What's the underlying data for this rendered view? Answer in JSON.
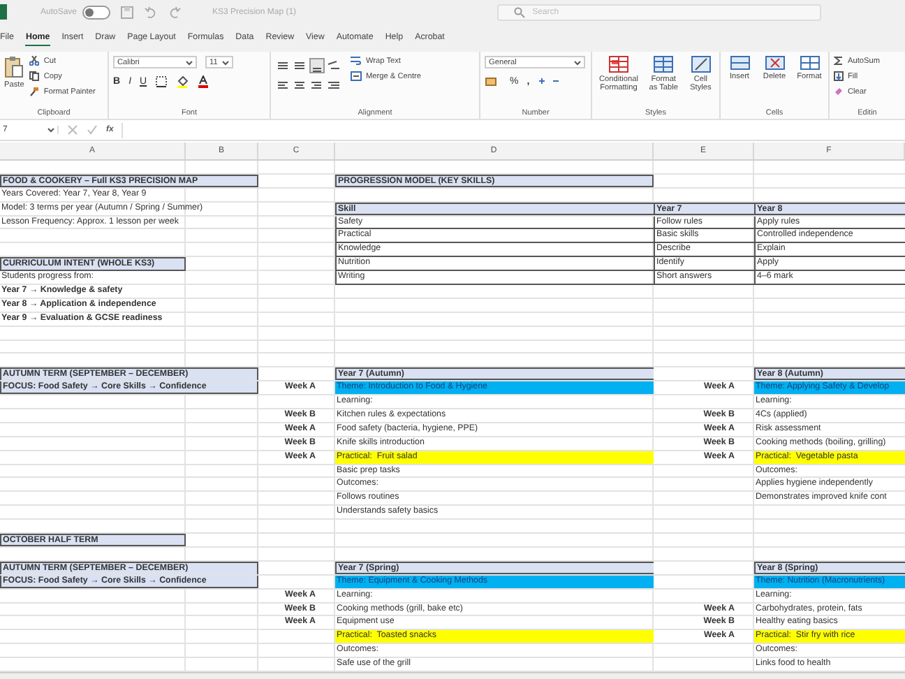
{
  "app": {
    "autosave": {
      "label": "AutoSave",
      "on": false
    },
    "title": "KS3 Precision Map (1)",
    "search": {
      "placeholder": "Search"
    }
  },
  "menu_tabs": [
    {
      "label": "File",
      "selected": false
    },
    {
      "label": "Home",
      "selected": true
    },
    {
      "label": "Insert",
      "selected": false
    },
    {
      "label": "Draw",
      "selected": false
    },
    {
      "label": "Page Layout",
      "selected": false
    },
    {
      "label": "Formulas",
      "selected": false
    },
    {
      "label": "Data",
      "selected": false
    },
    {
      "label": "Review",
      "selected": false
    },
    {
      "label": "View",
      "selected": false
    },
    {
      "label": "Automate",
      "selected": false
    },
    {
      "label": "Help",
      "selected": false
    },
    {
      "label": "Acrobat",
      "selected": false
    }
  ],
  "ribbon": {
    "clipboard": {
      "paste": "Paste",
      "cut": "Cut",
      "copy": "Copy",
      "format_painter": "Format Painter",
      "label": "Clipboard"
    },
    "font": {
      "family": "Calibri",
      "size": "11",
      "bold": "B",
      "italic": "I",
      "underline": "U",
      "label": "Font"
    },
    "alignment": {
      "wrap_text": "Wrap Text",
      "merge": "Merge & Centre",
      "label": "Alignment"
    },
    "number": {
      "format": "General",
      "percent": "%",
      "comma": ",",
      "label": "Number"
    },
    "styles": {
      "conditional": "Conditional Formatting",
      "format_table": "Format as Table",
      "cell_styles": "Cell Styles",
      "label": "Styles"
    },
    "cells": {
      "insert": "Insert",
      "delete": "Delete",
      "format": "Format",
      "label": "Cells"
    },
    "editing": {
      "autosum": "AutoSum",
      "fill": "Fill",
      "clear": "Clear",
      "label": "Editin"
    }
  },
  "formula_bar": {
    "name_box": "7",
    "function_label": "fx"
  },
  "columns": [
    "A",
    "B",
    "C",
    "D",
    "E",
    "F"
  ],
  "rows": [
    {},
    {
      "column_a": {
        "text": "FOOD & COOKERY – Full KS3 PRECISION MAP",
        "kind": "section_wide"
      },
      "column_d": {
        "text": "PROGRESSION MODEL (KEY SKILLS)",
        "kind": "section"
      }
    },
    {
      "column_a": {
        "text": "Years Covered: Year 7, Year 8, Year 9",
        "kind": "plain"
      }
    },
    {
      "column_a": {
        "text": "Model: 3 terms per year (Autumn / Spring / Summer)",
        "kind": "plain"
      },
      "column_d": {
        "text": "Skill",
        "kind": "table_head"
      },
      "column_e": {
        "text": "Year 7",
        "kind": "table_head"
      },
      "column_f": {
        "text": "Year 8",
        "kind": "table_head"
      }
    },
    {
      "column_a": {
        "text": "Lesson Frequency: Approx. 1 lesson per week",
        "kind": "plain"
      },
      "column_d": {
        "text": "Safety",
        "kind": "table"
      },
      "column_e": {
        "text": "Follow rules",
        "kind": "table"
      },
      "column_f": {
        "text": "Apply rules",
        "kind": "table"
      }
    },
    {
      "column_d": {
        "text": "Practical",
        "kind": "table"
      },
      "column_e": {
        "text": "Basic skills",
        "kind": "table"
      },
      "column_f": {
        "text": "Controlled independence",
        "kind": "table"
      }
    },
    {
      "column_d": {
        "text": "Knowledge",
        "kind": "table"
      },
      "column_e": {
        "text": "Describe",
        "kind": "table"
      },
      "column_f": {
        "text": "Explain",
        "kind": "table"
      }
    },
    {
      "column_a": {
        "text": "CURRICULUM INTENT (WHOLE KS3)",
        "kind": "section"
      },
      "column_d": {
        "text": "Nutrition",
        "kind": "table"
      },
      "column_e": {
        "text": "Identify",
        "kind": "table"
      },
      "column_f": {
        "text": "Apply",
        "kind": "table"
      }
    },
    {
      "column_a": {
        "text": "Students progress from:",
        "kind": "plain"
      },
      "column_d": {
        "text": "Writing",
        "kind": "table"
      },
      "column_e": {
        "text": "Short answers",
        "kind": "table"
      },
      "column_f": {
        "text": "4–6 mark",
        "kind": "table"
      }
    },
    {
      "column_a": {
        "text": "Year 7 → Knowledge & safety",
        "kind": "bold"
      }
    },
    {
      "column_a": {
        "text": "Year 8 → Application & independence",
        "kind": "bold"
      }
    },
    {
      "column_a": {
        "text": "Year 9 → Evaluation & GCSE readiness",
        "kind": "bold"
      }
    },
    {},
    {},
    {},
    {
      "column_a": {
        "text": "AUTUMN TERM (SEPTEMBER – DECEMBER)",
        "kind": "section_top"
      },
      "column_d": {
        "text": "Year 7 (Autumn)",
        "kind": "table_head"
      },
      "column_f": {
        "text": "Year 8 (Autumn)",
        "kind": "table_head"
      }
    },
    {
      "column_a": {
        "text": "FOCUS: Food Safety → Core Skills → Confidence",
        "kind": "section_bottom"
      },
      "column_c": {
        "text": "Week A",
        "kind": "week"
      },
      "column_d": {
        "text": "Theme: Introduction to Food & Hygiene",
        "kind": "theme"
      },
      "column_e": {
        "text": "Week A",
        "kind": "week"
      },
      "column_f": {
        "text": "Theme: Applying Safety & Develop",
        "kind": "theme"
      }
    },
    {
      "column_d": {
        "text": "Learning:",
        "kind": "plain"
      },
      "column_f": {
        "text": "Learning:",
        "kind": "plain"
      }
    },
    {
      "column_c": {
        "text": "Week B",
        "kind": "week"
      },
      "column_d": {
        "text": "Kitchen rules & expectations",
        "kind": "plain"
      },
      "column_e": {
        "text": "Week B",
        "kind": "week"
      },
      "column_f": {
        "text": "4Cs (applied)",
        "kind": "plain"
      }
    },
    {
      "column_c": {
        "text": "Week A",
        "kind": "week"
      },
      "column_d": {
        "text": "Food safety (bacteria, hygiene, PPE)",
        "kind": "plain"
      },
      "column_e": {
        "text": "Week A",
        "kind": "week"
      },
      "column_f": {
        "text": "Risk assessment",
        "kind": "plain"
      }
    },
    {
      "column_c": {
        "text": "Week B",
        "kind": "week"
      },
      "column_d": {
        "text": "Knife skills introduction",
        "kind": "plain"
      },
      "column_e": {
        "text": "Week B",
        "kind": "week"
      },
      "column_f": {
        "text": "Cooking methods (boiling, grilling)",
        "kind": "plain"
      }
    },
    {
      "column_c": {
        "text": "Week A",
        "kind": "week"
      },
      "column_d": {
        "text": "Practical:  Fruit salad",
        "kind": "practical"
      },
      "column_e": {
        "text": "Week A",
        "kind": "week"
      },
      "column_f": {
        "text": "Practical:  Vegetable pasta",
        "kind": "practical"
      }
    },
    {
      "column_d": {
        "text": "Basic prep tasks",
        "kind": "plain"
      },
      "column_f": {
        "text": "Outcomes:",
        "kind": "plain"
      }
    },
    {
      "column_d": {
        "text": "Outcomes:",
        "kind": "plain"
      },
      "column_f": {
        "text": "Applies hygiene independently",
        "kind": "plain"
      }
    },
    {
      "column_d": {
        "text": "Follows routines",
        "kind": "plain"
      },
      "column_f": {
        "text": "Demonstrates improved knife cont",
        "kind": "plain"
      }
    },
    {
      "column_d": {
        "text": "Understands safety basics",
        "kind": "plain"
      }
    },
    {},
    {
      "column_a": {
        "text": "OCTOBER HALF TERM",
        "kind": "section"
      }
    },
    {},
    {
      "column_a": {
        "text": "AUTUMN TERM (SEPTEMBER – DECEMBER)",
        "kind": "section_top"
      },
      "column_d": {
        "text": "Year 7 (Spring)",
        "kind": "table_head"
      },
      "column_f": {
        "text": "Year 8 (Spring)",
        "kind": "table_head"
      }
    },
    {
      "column_a": {
        "text": "FOCUS: Food Safety → Core Skills → Confidence",
        "kind": "section_bottom"
      },
      "column_d": {
        "text": "Theme: Equipment & Cooking Methods",
        "kind": "theme"
      },
      "column_f": {
        "text": "Theme: Nutrition (Macronutrients)",
        "kind": "theme"
      }
    },
    {
      "column_c": {
        "text": "Week A",
        "kind": "week"
      },
      "column_d": {
        "text": "Learning:",
        "kind": "plain"
      },
      "column_f": {
        "text": "Learning:",
        "kind": "plain"
      }
    },
    {
      "column_c": {
        "text": "Week B",
        "kind": "week"
      },
      "column_d": {
        "text": "Cooking methods (grill, bake etc)",
        "kind": "plain"
      },
      "column_e": {
        "text": "Week A",
        "kind": "week"
      },
      "column_f": {
        "text": "Carbohydrates, protein, fats",
        "kind": "plain"
      }
    },
    {
      "column_c": {
        "text": "Week A",
        "kind": "week"
      },
      "column_d": {
        "text": "Equipment use",
        "kind": "plain"
      },
      "column_e": {
        "text": "Week B",
        "kind": "week"
      },
      "column_f": {
        "text": "Healthy eating basics",
        "kind": "plain"
      }
    },
    {
      "column_d": {
        "text": "Practical:  Toasted snacks",
        "kind": "practical"
      },
      "column_e": {
        "text": "Week A",
        "kind": "week"
      },
      "column_f": {
        "text": "Practical:  Stir fry with rice",
        "kind": "practical"
      }
    },
    {
      "column_d": {
        "text": "Outcomes:",
        "kind": "plain"
      },
      "column_f": {
        "text": "Outcomes:",
        "kind": "plain"
      }
    },
    {
      "column_d": {
        "text": "Safe use of the grill",
        "kind": "plain"
      },
      "column_f": {
        "text": "Links food to health",
        "kind": "plain"
      }
    }
  ]
}
